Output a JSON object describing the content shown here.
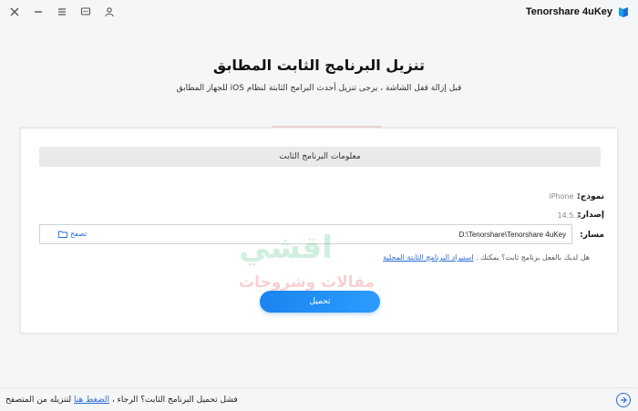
{
  "app": {
    "title": "Tenorshare 4uKey"
  },
  "titlebar": {
    "icons": [
      "close-icon",
      "minimize-icon",
      "menu-icon",
      "feedback-icon",
      "account-icon"
    ]
  },
  "page": {
    "title": "تنزيل البرنامج الثابت المطابق",
    "subtitle": "قبل إزالة قفل الشاشة ، يرجى تنزيل أحدث البرامج الثابتة لنظام iOS للجهاز المطابق"
  },
  "firmware": {
    "section_title": "معلومات البرنامج الثابت",
    "model_label": "نموذج:",
    "model_value": "iPhone 7",
    "version_label": "إصدار:",
    "version_value": "14.5.1",
    "path_label": "مسار:",
    "path_value": "D:\\Tenorshare\\Tenorshare 4uKey",
    "browse_label": "تصفح",
    "hint_text": "هل لديك بالفعل برنامج ثابت؟ يمكنك . ",
    "hint_link": "استيراد البرنامج الثابتة المحلية",
    "download_button": "تحميل"
  },
  "watermark": {
    "line1": "اقشي",
    "line2": "مقالات وشروحات"
  },
  "footer": {
    "text_before": "فشل تحميل البرنامج الثابت؟ الرجاء ، ",
    "link": "الضغط هنا",
    "text_after": " لتنزيله من المتصفح"
  },
  "colors": {
    "accent": "#2a6bd6",
    "button": "#1a84f0"
  }
}
